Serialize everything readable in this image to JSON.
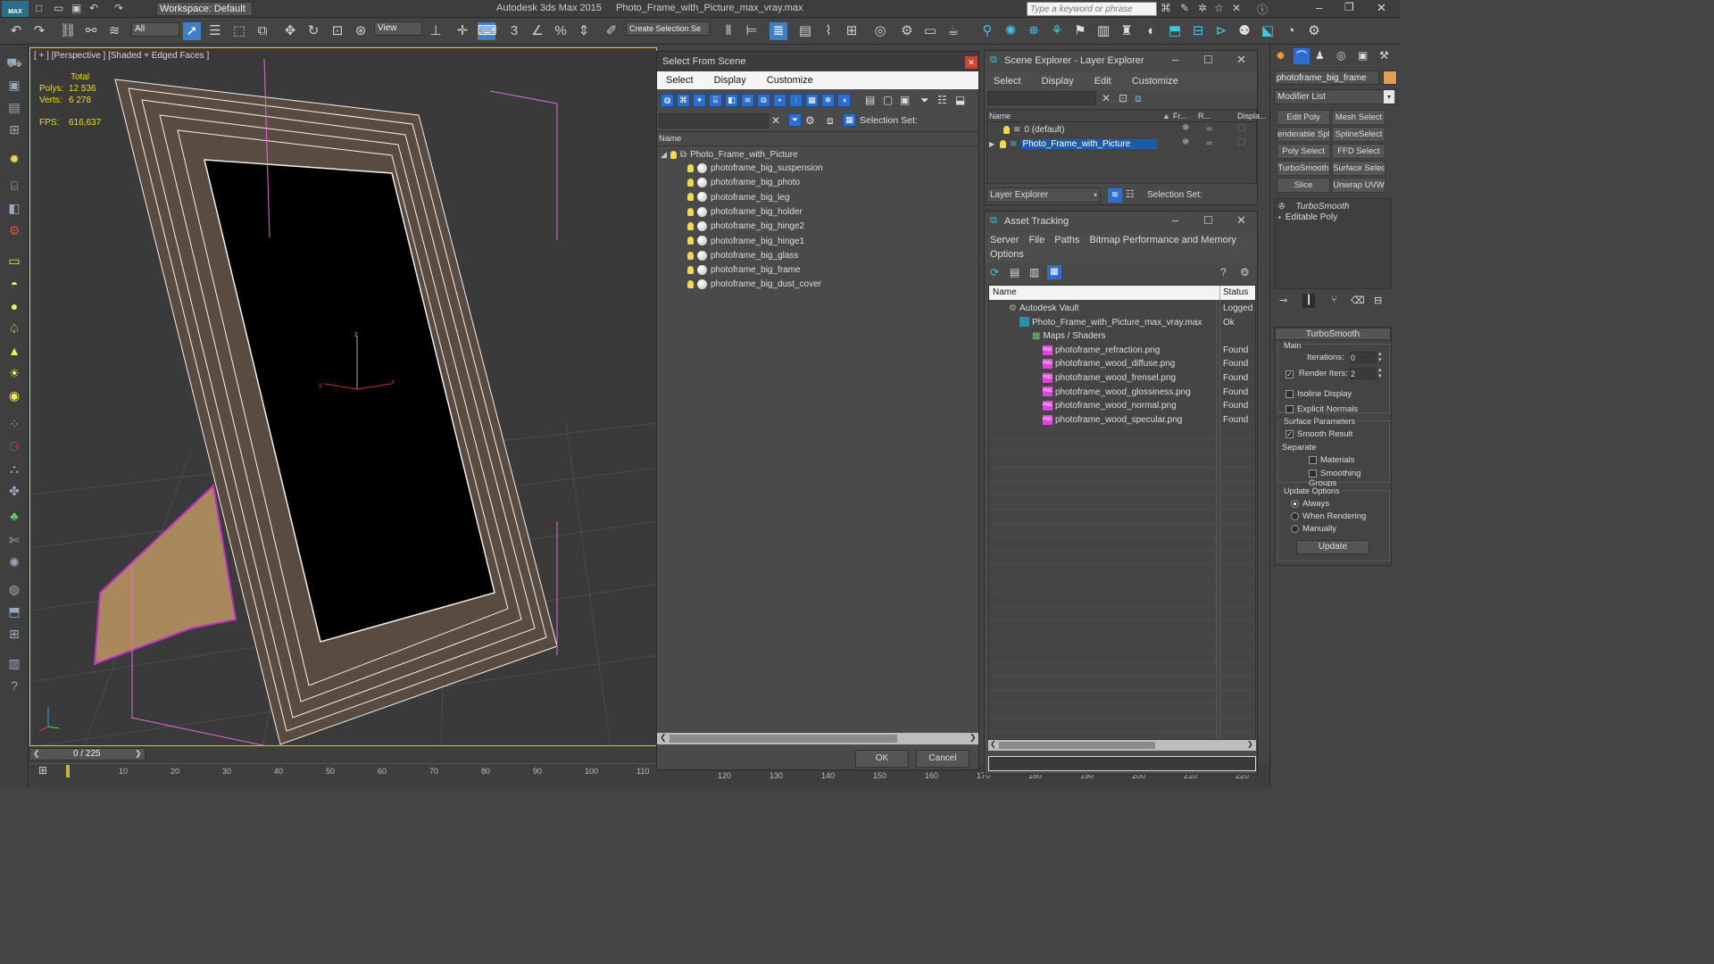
{
  "app": {
    "title": "Autodesk 3ds Max  2015",
    "file": "Photo_Frame_with_Picture_max_vray.max",
    "workspace": "Workspace: Default",
    "search_placeholder": "Type a keyword or phrase",
    "logo": "MAX"
  },
  "toolbar": {
    "filter": "All",
    "refcoord": "View",
    "create_selection": "Create Selection Se"
  },
  "viewport": {
    "label": "[ + ] [Perspective ] [Shaded + Edged Faces ]",
    "stats": {
      "total_label": "Total",
      "polys_label": "Polys:",
      "polys_value": "12 536",
      "verts_label": "Verts:",
      "verts_value": "6 278",
      "fps_label": "FPS:",
      "fps_value": "616,637"
    },
    "axis_z": "z",
    "axis_y": "y",
    "axis_x": "x"
  },
  "select_scene": {
    "title": "Select From Scene",
    "menu": [
      "Select",
      "Display",
      "Customize"
    ],
    "selection_set_label": "Selection Set:",
    "column_name": "Name",
    "root": "Photo_Frame_with_Picture",
    "items": [
      "photoframe_big_suspension",
      "photoframe_big_photo",
      "photoframe_big_leg",
      "photoframe_big_holder",
      "photoframe_big_hinge2",
      "photoframe_big_hinge1",
      "photoframe_big_glass",
      "photoframe_big_frame",
      "photoframe_big_dust_cover"
    ],
    "ok": "OK",
    "cancel": "Cancel"
  },
  "scene_explorer": {
    "title": "Scene Explorer - Layer Explorer",
    "menu": [
      "Select",
      "Display",
      "Edit",
      "Customize"
    ],
    "columns": {
      "name": "Name",
      "freeze": "Fr...",
      "render": "R...",
      "display": "Displa..."
    },
    "layers": [
      "0 (default)",
      "Photo_Frame_with_Picture"
    ],
    "footer_dropdown": "Layer Explorer",
    "selection_set_label": "Selection Set:"
  },
  "asset_tracking": {
    "title": "Asset Tracking",
    "menu": [
      "Server",
      "File",
      "Paths",
      "Bitmap Performance and Memory"
    ],
    "menu2": "Options",
    "columns": {
      "name": "Name",
      "status": "Status"
    },
    "rows": [
      {
        "name": "Autodesk Vault",
        "status": "Logged",
        "level": 0
      },
      {
        "name": "Photo_Frame_with_Picture_max_vray.max",
        "status": "Ok",
        "level": 1
      },
      {
        "name": "Maps / Shaders",
        "status": "",
        "level": 2
      },
      {
        "name": "photoframe_refraction.png",
        "status": "Found",
        "level": 3
      },
      {
        "name": "photoframe_wood_diffuse.png",
        "status": "Found",
        "level": 3
      },
      {
        "name": "photoframe_wood_frensel.png",
        "status": "Found",
        "level": 3
      },
      {
        "name": "photoframe_wood_glossiness.png",
        "status": "Found",
        "level": 3
      },
      {
        "name": "photoframe_wood_normal.png",
        "status": "Found",
        "level": 3
      },
      {
        "name": "photoframe_wood_specular.png",
        "status": "Found",
        "level": 3
      }
    ]
  },
  "command_panel": {
    "object_name": "photoframe_big_frame",
    "modifier_list": "Modifier List",
    "buttons": [
      [
        "Edit Poly",
        "Mesh Select"
      ],
      [
        "enderable Splir",
        "SplineSelect"
      ],
      [
        "Poly Select",
        "FFD Select"
      ],
      [
        "TurboSmooth",
        "Surface Select"
      ],
      [
        "Slice",
        "Unwrap UVW"
      ]
    ],
    "stack": [
      "TurboSmooth",
      "Editable Poly"
    ],
    "rollout_title": "TurboSmooth",
    "main_label": "Main",
    "iterations_label": "Iterations:",
    "iterations_value": "0",
    "render_iters_label": "Render Iters:",
    "render_iters_value": "2",
    "isoline": "Isoline Display",
    "explicit_normals": "Explicit Normals",
    "surface_params": "Surface Parameters",
    "smooth_result": "Smooth Result",
    "separate": "Separate",
    "materials": "Materials",
    "smoothing_groups": "Smoothing Groups",
    "update_options": "Update Options",
    "always": "Always",
    "when_rendering": "When Rendering",
    "manually": "Manually",
    "update": "Update"
  },
  "timeline": {
    "frame": "0 / 225",
    "ticks": [
      "10",
      "20",
      "30",
      "40",
      "50",
      "60",
      "70",
      "80",
      "90",
      "100",
      "110",
      "120",
      "130",
      "140",
      "150",
      "160",
      "170",
      "180",
      "190",
      "200",
      "210",
      "220"
    ]
  },
  "colors": {
    "accent_blue": "#1e5ca8",
    "viewport_border": "#e8c230",
    "stats_yellow": "#e6e000"
  }
}
